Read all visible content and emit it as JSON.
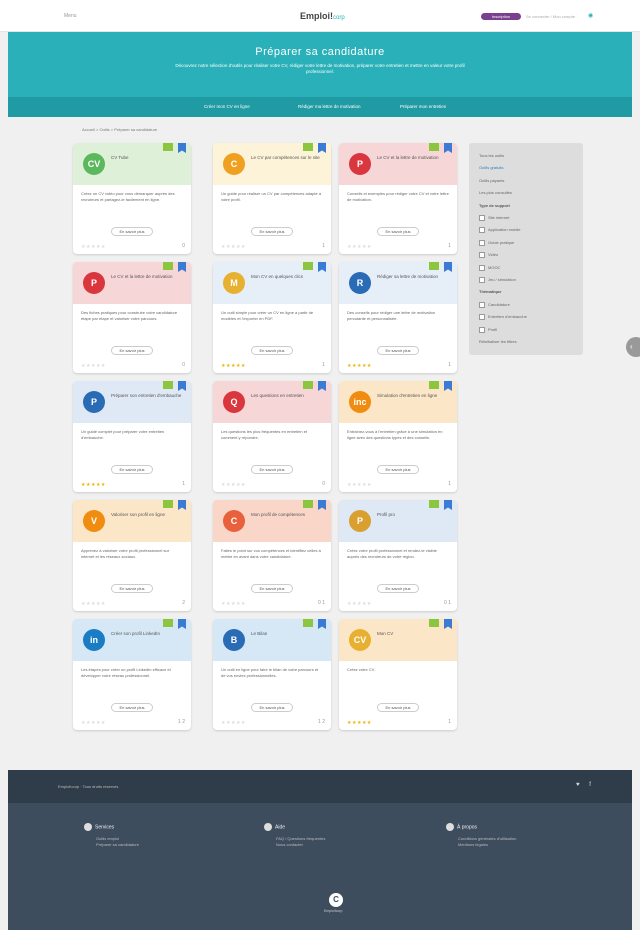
{
  "header": {
    "menu_label": "Menu",
    "logo_main": "Emploi!",
    "logo_sub": "corp",
    "cta": "Inscription",
    "login": "Se connecter / Mon compte",
    "account_icon": "user-icon"
  },
  "hero": {
    "title": "Préparer sa candidature",
    "text": "Découvrez notre sélection d'outils pour réaliser votre CV, rédiger votre lettre de motivation, préparer votre entretien et mettre en valeur votre profil professionnel."
  },
  "tabs": [
    "Créer mon CV en ligne",
    "Rédiger ma lettre de motivation",
    "Préparer mon entretien"
  ],
  "breadcrumb": "Accueil > Outils > Préparer sa candidature",
  "cards": [
    {
      "title": "CV Tube",
      "color": "#5cb85c",
      "icon": "CV",
      "bg": "#dff0d8",
      "desc": "Créez un CV vidéo pour vous démarquer auprès des recruteurs et partagez-le facilement en ligne.",
      "button": "En savoir plus",
      "stars": "★★★★★",
      "rated": false,
      "count": "0"
    },
    {
      "title": "Le CV par compétences sur le site",
      "color": "#f0a020",
      "icon": "C",
      "bg": "#fcf3d8",
      "desc": "Un guide pour réaliser un CV par compétences adapté à votre profil.",
      "button": "En savoir plus",
      "stars": "★★★★★",
      "rated": false,
      "count": "1"
    },
    {
      "title": "Le CV et la lettre de motivation",
      "color": "#d9363e",
      "icon": "P",
      "bg": "#f6d6d6",
      "desc": "Conseils et exemples pour rédiger votre CV et votre lettre de motivation.",
      "button": "En savoir plus",
      "stars": "★★★★★",
      "rated": false,
      "count": "1"
    },
    {
      "title": "Le CV et la lettre de motivation",
      "color": "#d9363e",
      "icon": "P",
      "bg": "#f6d6d6",
      "desc": "Des fiches pratiques pour construire votre candidature étape par étape et valoriser votre parcours.",
      "button": "En savoir plus",
      "stars": "★★★★★",
      "rated": false,
      "count": "0"
    },
    {
      "title": "Mon CV en quelques clics",
      "color": "#e8b030",
      "icon": "M",
      "bg": "#e6eef8",
      "desc": "Un outil simple pour créer un CV en ligne à partir de modèles et l'exporter en PDF.",
      "button": "En savoir plus",
      "stars": "★★★★★",
      "rated": true,
      "count": "1"
    },
    {
      "title": "Rédiger sa lettre de motivation",
      "color": "#2a6bb5",
      "icon": "R",
      "bg": "#e6eef8",
      "desc": "Des conseils pour rédiger une lettre de motivation percutante et personnalisée.",
      "button": "En savoir plus",
      "stars": "★★★★★",
      "rated": true,
      "count": "1"
    },
    {
      "title": "Préparer son entretien d'embauche",
      "color": "#2a6bb5",
      "icon": "P",
      "bg": "#dfe8f5",
      "desc": "Un guide complet pour préparer votre entretien d'embauche.",
      "button": "En savoir plus",
      "stars": "★★★★★",
      "rated": true,
      "count": "1"
    },
    {
      "title": "Les questions en entretien",
      "color": "#d9363e",
      "icon": "Q",
      "bg": "#f6d6d6",
      "desc": "Les questions les plus fréquentes en entretien et comment y répondre.",
      "button": "En savoir plus",
      "stars": "★★★★★",
      "rated": false,
      "count": "0"
    },
    {
      "title": "Simulation d'entretien en ligne",
      "color": "#f08c10",
      "icon": "inc",
      "bg": "#fce6c8",
      "desc": "Entraînez-vous à l'entretien grâce à une simulation en ligne avec des questions types et des conseils.",
      "button": "En savoir plus",
      "stars": "★★★★★",
      "rated": false,
      "count": "1"
    },
    {
      "title": "Valoriser son profil en ligne",
      "color": "#f08c10",
      "icon": "V",
      "bg": "#fce6c8",
      "desc": "Apprenez à valoriser votre profil professionnel sur internet et les réseaux sociaux.",
      "button": "En savoir plus",
      "stars": "★★★★★",
      "rated": false,
      "count": "2"
    },
    {
      "title": "Mon profil de compétences",
      "color": "#e8603c",
      "icon": "C",
      "bg": "#fad6c8",
      "desc": "Faites le point sur vos compétences et identifiez celles à mettre en avant dans votre candidature.",
      "button": "En savoir plus",
      "stars": "★★★★★",
      "rated": false,
      "count": "0 1"
    },
    {
      "title": "Profil pro",
      "color": "#d9a030",
      "icon": "P",
      "bg": "#dfe8f5",
      "desc": "Créez votre profil professionnel et rendez-le visible auprès des recruteurs de votre région.",
      "button": "En savoir plus",
      "stars": "★★★★★",
      "rated": false,
      "count": "0 1"
    },
    {
      "title": "Créer son profil LinkedIn",
      "color": "#1a7dc4",
      "icon": "in",
      "bg": "#d6e8f6",
      "desc": "Les étapes pour créer un profil LinkedIn efficace et développer votre réseau professionnel.",
      "button": "En savoir plus",
      "stars": "★★★★★",
      "rated": false,
      "count": "1 2"
    },
    {
      "title": "Le Bilan",
      "color": "#2a6bb5",
      "icon": "B",
      "bg": "#d6e8f6",
      "desc": "Un outil en ligne pour faire le bilan de votre parcours et de vos envies professionnelles.",
      "button": "En savoir plus",
      "stars": "★★★★★",
      "rated": false,
      "count": "1 2"
    },
    {
      "title": "Mon CV",
      "color": "#e8b030",
      "icon": "CV",
      "bg": "#fce6c8",
      "desc": "Créez votre CV.",
      "button": "En savoir plus",
      "stars": "★★★★★",
      "rated": true,
      "count": "1"
    }
  ],
  "filter": {
    "items": [
      {
        "label": "Tous les outils",
        "type": "plain",
        "on": false
      },
      {
        "label": "Outils gratuits",
        "type": "plain",
        "on": true
      },
      {
        "label": "Outils payants",
        "type": "plain",
        "on": false
      },
      {
        "label": "Les plus consultés",
        "type": "plain",
        "on": false
      },
      {
        "label": "Type de support",
        "type": "head",
        "on": false
      },
      {
        "label": "Site internet",
        "type": "check",
        "on": false
      },
      {
        "label": "Application mobile",
        "type": "check",
        "on": false
      },
      {
        "label": "Guide pratique",
        "type": "check",
        "on": false
      },
      {
        "label": "Vidéo",
        "type": "check",
        "on": false
      },
      {
        "label": "MOOC",
        "type": "check",
        "on": false
      },
      {
        "label": "Jeu / simulation",
        "type": "check",
        "on": false
      },
      {
        "label": "Thématique",
        "type": "head",
        "on": false
      },
      {
        "label": "Candidature",
        "type": "check",
        "on": false
      },
      {
        "label": "Entretien d'embauche",
        "type": "check",
        "on": false
      },
      {
        "label": "Profil",
        "type": "check",
        "on": false
      },
      {
        "label": "Réinitialiser les filtres",
        "type": "plain",
        "on": false
      }
    ]
  },
  "footer": {
    "tagline": "Emploi!corp · Tous droits réservés",
    "social": "♥ f",
    "cols": [
      {
        "title": "Services",
        "links": [
          "Outils emploi",
          "Préparer sa candidature"
        ]
      },
      {
        "title": "Aide",
        "links": [
          "FAQ / Questions fréquentes",
          "Nous contacter"
        ]
      },
      {
        "title": "À propos",
        "links": [
          "Conditions générales d'utilisation",
          "Mentions légales"
        ]
      }
    ],
    "badge": "C",
    "badge_label": "Emploi!corp"
  },
  "colors": {
    "accent": "#2ab0b8",
    "tabbar": "#219ba3",
    "footer": "#3e4d5e",
    "cta": "#7a3f8f"
  }
}
